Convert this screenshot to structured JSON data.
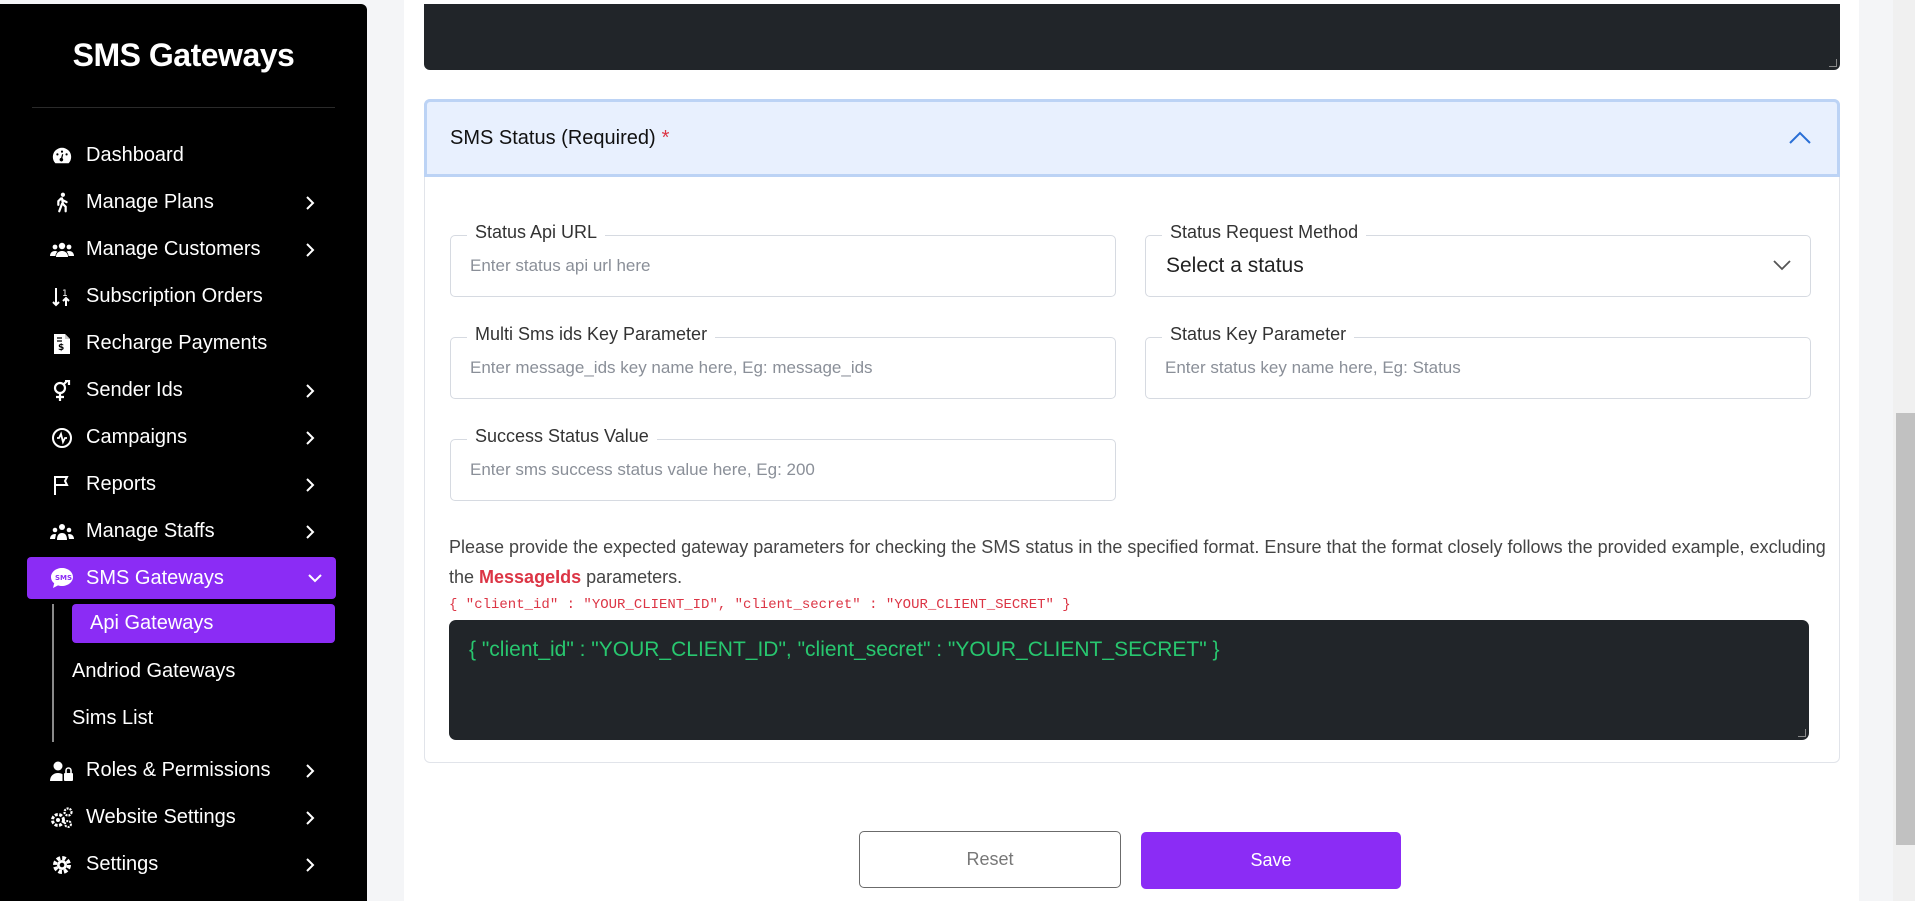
{
  "sidebar": {
    "brand": "SMS Gateways",
    "items": [
      {
        "label": "Dashboard",
        "icon": "dashboard-icon",
        "has_children": false
      },
      {
        "label": "Manage Plans",
        "icon": "walking-person-icon",
        "has_children": true
      },
      {
        "label": "Manage Customers",
        "icon": "users-icon",
        "has_children": true
      },
      {
        "label": "Subscription Orders",
        "icon": "sort-icon",
        "has_children": false
      },
      {
        "label": "Recharge Payments",
        "icon": "invoice-icon",
        "has_children": false
      },
      {
        "label": "Sender Ids",
        "icon": "gender-icon",
        "has_children": true
      },
      {
        "label": "Campaigns",
        "icon": "campaign-icon",
        "has_children": true
      },
      {
        "label": "Reports",
        "icon": "flag-icon",
        "has_children": true
      },
      {
        "label": "Manage Staffs",
        "icon": "staff-icon",
        "has_children": true
      },
      {
        "label": "SMS Gateways",
        "icon": "sms-icon",
        "has_children": true,
        "active": true
      }
    ],
    "sub_items": [
      {
        "label": "Api Gateways",
        "active": true
      },
      {
        "label": "Andriod Gateways"
      },
      {
        "label": "Sims List"
      }
    ],
    "items_after": [
      {
        "label": "Roles & Permissions",
        "icon": "user-lock-icon",
        "has_children": true
      },
      {
        "label": "Website Settings",
        "icon": "cogs-icon",
        "has_children": true
      },
      {
        "label": "Settings",
        "icon": "gear-icon",
        "has_children": true
      }
    ],
    "accent": "#8b2cf5"
  },
  "section": {
    "title": "SMS Status (Required)",
    "required_mark": "*"
  },
  "fields": {
    "status_api_url": {
      "label": "Status Api URL",
      "placeholder": "Enter status api url here"
    },
    "status_request_method": {
      "label": "Status Request Method",
      "value": "Select a status"
    },
    "multi_sms_ids": {
      "label": "Multi Sms ids Key Parameter",
      "placeholder": "Enter message_ids key name here, Eg: message_ids"
    },
    "status_key": {
      "label": "Status Key Parameter",
      "placeholder": "Enter status key name here, Eg: Status"
    },
    "success_status": {
      "label": "Success Status Value",
      "placeholder": "Enter sms success status value here, Eg: 200"
    }
  },
  "help": {
    "text_before": "Please provide the expected gateway parameters for checking the SMS status in the specified format. Ensure that the format closely follows the provided example, excluding the ",
    "highlight": "MessageIds",
    "text_after": " parameters.",
    "example": "{ \"client_id\" : \"YOUR_CLIENT_ID\", \"client_secret\" : \"YOUR_CLIENT_SECRET\" }",
    "code_value": "{ \"client_id\" : \"YOUR_CLIENT_ID\", \"client_secret\" : \"YOUR_CLIENT_SECRET\" }"
  },
  "buttons": {
    "reset": "Reset",
    "save": "Save"
  }
}
